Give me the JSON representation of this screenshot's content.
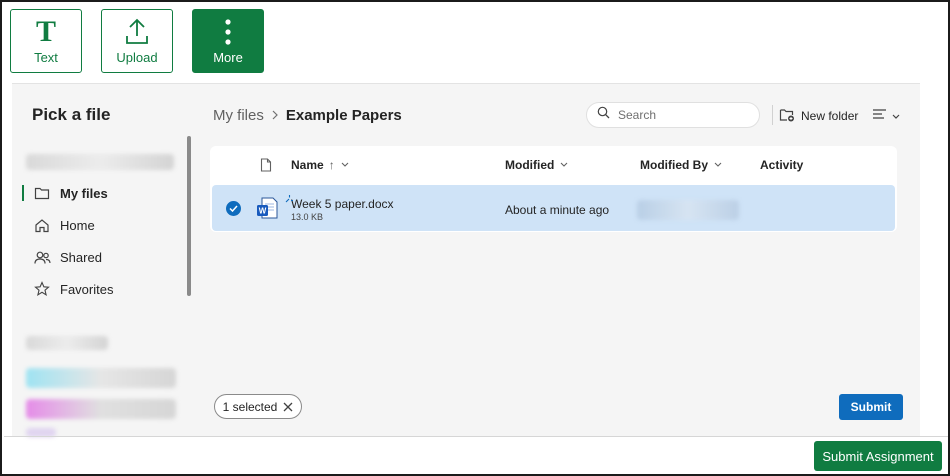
{
  "toolbar": {
    "text_label": "Text",
    "upload_label": "Upload",
    "more_label": "More",
    "text_icon": "T",
    "accent": "#107c41"
  },
  "picker": {
    "title": "Pick a file",
    "nav": [
      {
        "label": "My files",
        "icon": "folder-icon",
        "active": true
      },
      {
        "label": "Home",
        "icon": "home-icon"
      },
      {
        "label": "Shared",
        "icon": "people-icon"
      },
      {
        "label": "Favorites",
        "icon": "star-icon"
      }
    ],
    "breadcrumb": {
      "root": "My files",
      "current": "Example Papers"
    },
    "search_placeholder": "Search",
    "new_folder_label": "New folder",
    "columns": {
      "name": "Name",
      "name_sort": "↑",
      "modified": "Modified",
      "modified_by": "Modified By",
      "activity": "Activity"
    },
    "files": [
      {
        "name": "Week 5 paper.docx",
        "size": "13.0 KB",
        "modified": "About a minute ago",
        "selected": true
      }
    ],
    "selected_chip": "1 selected",
    "submit_label": "Submit",
    "submit_color": "#0f6cbd",
    "selected_row_color": "#cfe3f7"
  },
  "footer": {
    "submit_assignment_label": "Submit Assignment"
  }
}
